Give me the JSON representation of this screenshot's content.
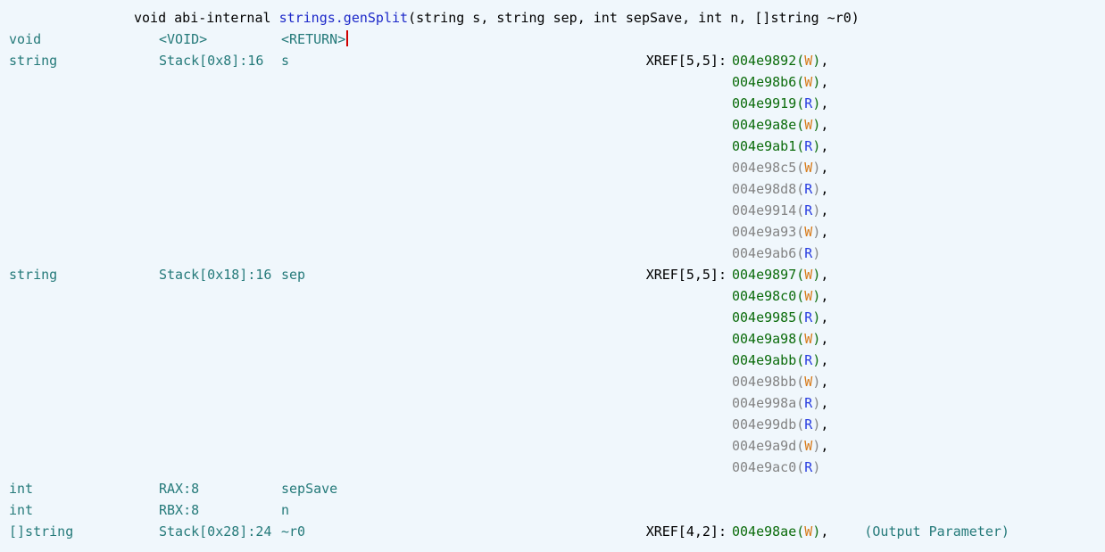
{
  "signature": {
    "prefix": "void abi-internal ",
    "funcName": "strings.genSplit",
    "paramsOpen": "(",
    "params": "string s, string sep, int sepSave, int n, []string ~r0",
    "paramsClose": ")"
  },
  "rows": [
    {
      "type": "void",
      "loc": "<VOID>",
      "name": "<RETURN>",
      "typeClass": "teal",
      "locClass": "teal",
      "nameClass": "teal",
      "xrefLabel": "",
      "xrefs": [],
      "cursor": true
    },
    {
      "type": "string",
      "loc": "Stack[0x8]:16",
      "name": "s",
      "typeClass": "teal",
      "locClass": "teal",
      "nameClass": "teal",
      "xrefLabel": "XREF[5,5]:",
      "xrefs": [
        {
          "addr": "004e9892",
          "rw": "W",
          "comma": true,
          "dim": false
        },
        {
          "addr": "004e98b6",
          "rw": "W",
          "comma": true,
          "dim": false
        },
        {
          "addr": "004e9919",
          "rw": "R",
          "comma": true,
          "dim": false
        },
        {
          "addr": "004e9a8e",
          "rw": "W",
          "comma": true,
          "dim": false
        },
        {
          "addr": "004e9ab1",
          "rw": "R",
          "comma": true,
          "dim": false
        },
        {
          "addr": "004e98c5",
          "rw": "W",
          "comma": true,
          "dim": true
        },
        {
          "addr": "004e98d8",
          "rw": "R",
          "comma": true,
          "dim": true
        },
        {
          "addr": "004e9914",
          "rw": "R",
          "comma": true,
          "dim": true
        },
        {
          "addr": "004e9a93",
          "rw": "W",
          "comma": true,
          "dim": true
        },
        {
          "addr": "004e9ab6",
          "rw": "R",
          "comma": false,
          "dim": true
        }
      ]
    },
    {
      "type": "string",
      "loc": "Stack[0x18]:16",
      "name": "sep",
      "typeClass": "teal",
      "locClass": "teal",
      "nameClass": "teal",
      "xrefLabel": "XREF[5,5]:",
      "xrefs": [
        {
          "addr": "004e9897",
          "rw": "W",
          "comma": true,
          "dim": false
        },
        {
          "addr": "004e98c0",
          "rw": "W",
          "comma": true,
          "dim": false
        },
        {
          "addr": "004e9985",
          "rw": "R",
          "comma": true,
          "dim": false
        },
        {
          "addr": "004e9a98",
          "rw": "W",
          "comma": true,
          "dim": false
        },
        {
          "addr": "004e9abb",
          "rw": "R",
          "comma": true,
          "dim": false
        },
        {
          "addr": "004e98bb",
          "rw": "W",
          "comma": true,
          "dim": true
        },
        {
          "addr": "004e998a",
          "rw": "R",
          "comma": true,
          "dim": true
        },
        {
          "addr": "004e99db",
          "rw": "R",
          "comma": true,
          "dim": true
        },
        {
          "addr": "004e9a9d",
          "rw": "W",
          "comma": true,
          "dim": true
        },
        {
          "addr": "004e9ac0",
          "rw": "R",
          "comma": false,
          "dim": true
        }
      ]
    },
    {
      "type": "int",
      "loc": "RAX:8",
      "name": "sepSave",
      "typeClass": "teal",
      "locClass": "teal",
      "nameClass": "teal",
      "xrefLabel": "",
      "xrefs": []
    },
    {
      "type": "int",
      "loc": "RBX:8",
      "name": "n",
      "typeClass": "teal",
      "locClass": "teal",
      "nameClass": "teal",
      "xrefLabel": "",
      "xrefs": []
    },
    {
      "type": "[]string",
      "loc": "Stack[0x28]:24",
      "name": "~r0",
      "typeClass": "teal",
      "locClass": "teal",
      "nameClass": "teal",
      "xrefLabel": "XREF[4,2]:",
      "xrefs": [
        {
          "addr": "004e98ae",
          "rw": "W",
          "comma": true,
          "dim": false
        }
      ],
      "trail": "(Output Parameter)"
    }
  ]
}
